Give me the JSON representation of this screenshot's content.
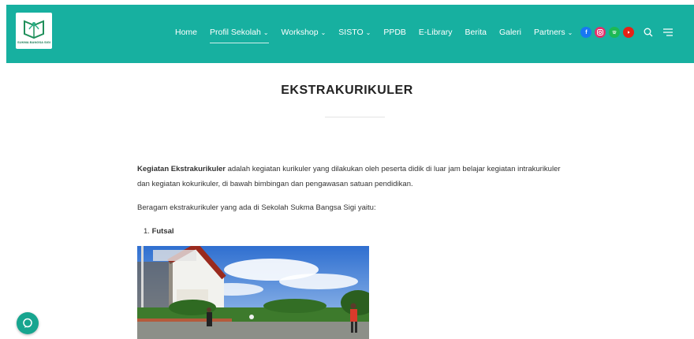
{
  "header": {
    "logo_alt": "SUKMA BANGSA SIGI",
    "nav": [
      {
        "label": "Home",
        "has_dropdown": false
      },
      {
        "label": "Profil Sekolah",
        "has_dropdown": true
      },
      {
        "label": "Workshop",
        "has_dropdown": true
      },
      {
        "label": "SISTO",
        "has_dropdown": true
      },
      {
        "label": "PPDB",
        "has_dropdown": false
      },
      {
        "label": "E-Library",
        "has_dropdown": false
      },
      {
        "label": "Berita",
        "has_dropdown": false
      },
      {
        "label": "Galeri",
        "has_dropdown": false
      },
      {
        "label": "Partners",
        "has_dropdown": true
      }
    ],
    "social_icons": [
      "facebook-icon",
      "instagram-icon",
      "spotify-icon",
      "youtube-icon"
    ],
    "tool_icons": [
      "search-icon",
      "menu-icon"
    ],
    "colors": {
      "bar": "#17b0a0",
      "active_underline": "#ffffff"
    }
  },
  "page": {
    "title": "EKSTRAKURIKULER"
  },
  "content": {
    "intro_bold": "Kegiatan Ekstrakurikuler",
    "intro_rest": " adalah kegiatan kurikuler yang dilakukan oleh peserta didik di luar jam belajar kegiatan intrakurikuler dan kegiatan kokurikuler, di bawah bimbingan dan pengawasan satuan pendidikan.",
    "list_intro": "Beragam ekstrakurikuler yang ada di Sekolah Sukma Bangsa Sigi yaitu:",
    "list_items": [
      {
        "number": "1.",
        "label": "Futsal"
      }
    ]
  },
  "widgets": {
    "chat_icon": "chat-icon",
    "chat_color": "#17a58f"
  }
}
